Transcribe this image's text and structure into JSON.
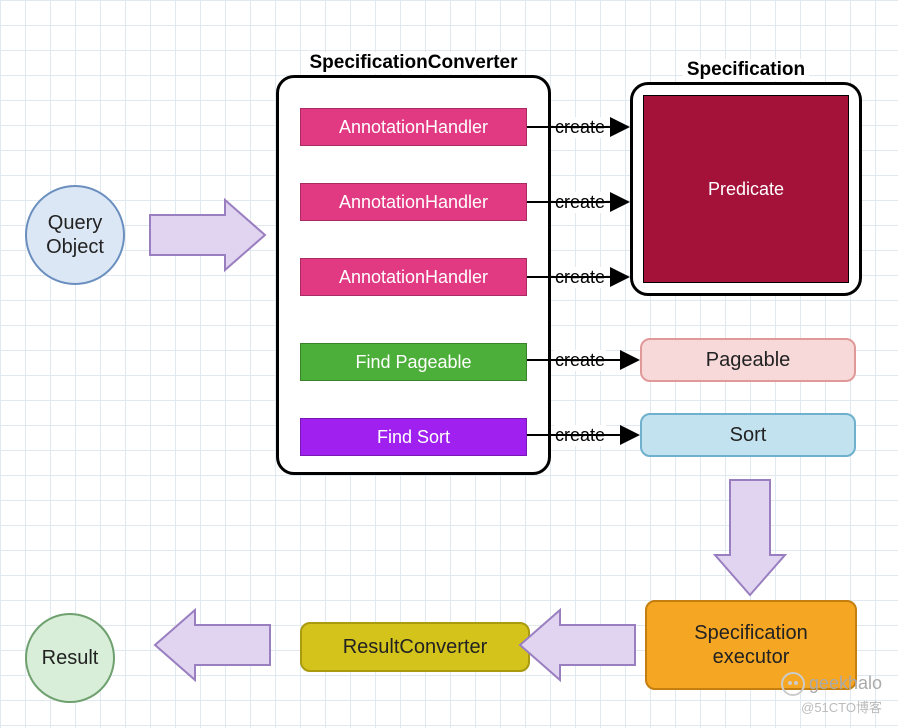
{
  "nodes": {
    "query_object": "Query\nObject",
    "result": "Result",
    "spec_converter_title": "SpecificationConverter",
    "specification_title": "Specification",
    "annotation_handler_1": "AnnotationHandler",
    "annotation_handler_2": "AnnotationHandler",
    "annotation_handler_3": "AnnotationHandler",
    "find_pageable": "Find Pageable",
    "find_sort": "Find Sort",
    "predicate": "Predicate",
    "pageable": "Pageable",
    "sort": "Sort",
    "spec_executor": "Specification\nexecutor",
    "result_converter": "ResultConverter"
  },
  "edges": {
    "create_1": "create",
    "create_2": "create",
    "create_3": "create",
    "create_4": "create",
    "create_5": "create"
  },
  "watermark": {
    "name": "geekhalo",
    "sub": "@51CTO博客"
  }
}
